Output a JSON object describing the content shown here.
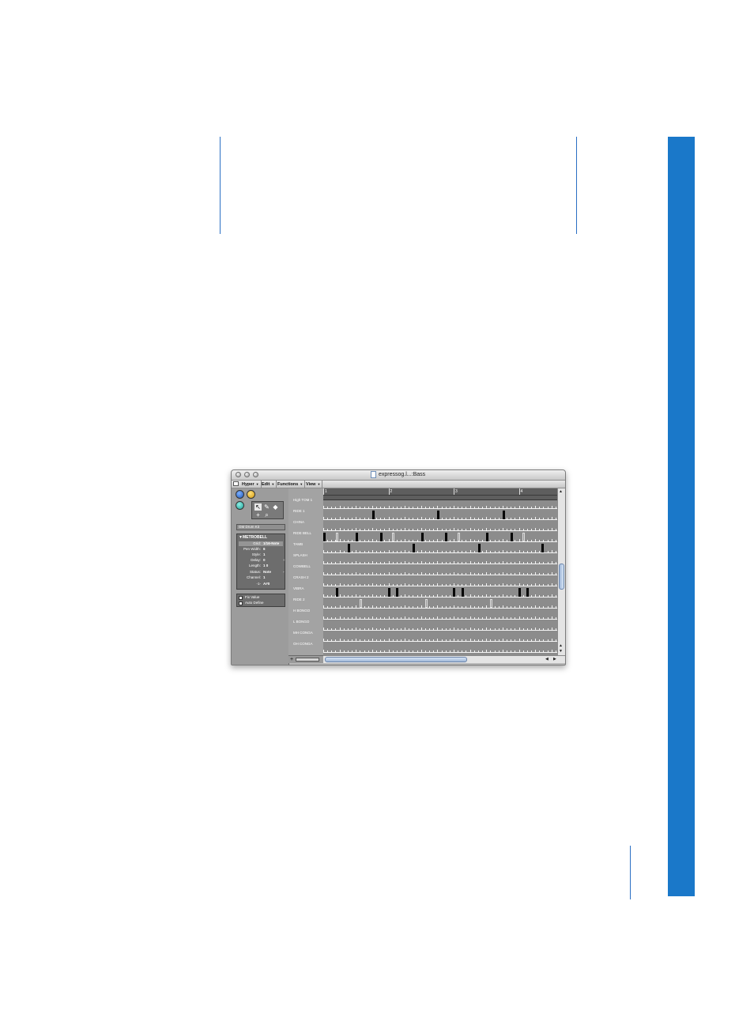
{
  "window": {
    "title": "expressog.l...:Bass"
  },
  "menu": {
    "items": [
      {
        "label": "Hyper"
      },
      {
        "label": "Edit"
      },
      {
        "label": "Functions"
      },
      {
        "label": "View"
      }
    ]
  },
  "inspector": {
    "kit_name": "GM Drum Kit",
    "section_title": "▼METROBELL",
    "params": [
      {
        "label": "Grid:",
        "value": "1/16-Note"
      },
      {
        "label": "Pen Width:",
        "value": "6"
      },
      {
        "label": "Style:",
        "value": "1"
      },
      {
        "label": "Delay:",
        "value": "0"
      },
      {
        "label": "Length:",
        "value": "1    0"
      },
      {
        "label": "Status:",
        "value": "Note"
      },
      {
        "label": "Channel:",
        "value": "1"
      },
      {
        "label": "-1-",
        "value": "A#0"
      }
    ],
    "checkboxes": [
      {
        "label": "Fix Value"
      },
      {
        "label": "Auto Define"
      }
    ]
  },
  "ruler": {
    "bars": [
      "1",
      "2",
      "3",
      "4"
    ]
  },
  "lanes": [
    {
      "name": "High TOM 1",
      "notes": []
    },
    {
      "name": "RIDE 1",
      "notes": [
        {
          "bar": 1.75,
          "shade": "black"
        },
        {
          "bar": 2.75,
          "shade": "black"
        },
        {
          "bar": 3.75,
          "shade": "black"
        }
      ]
    },
    {
      "name": "CHINA",
      "notes": []
    },
    {
      "name": "RIDE BELL",
      "notes": [
        {
          "bar": 1.0,
          "shade": "black"
        },
        {
          "bar": 1.19,
          "shade": "grey"
        },
        {
          "bar": 1.5,
          "shade": "black"
        },
        {
          "bar": 1.87,
          "shade": "black"
        },
        {
          "bar": 2.06,
          "shade": "grey"
        },
        {
          "bar": 2.5,
          "shade": "black"
        },
        {
          "bar": 2.87,
          "shade": "black"
        },
        {
          "bar": 3.06,
          "shade": "grey"
        },
        {
          "bar": 3.5,
          "shade": "black"
        },
        {
          "bar": 3.87,
          "shade": "black"
        },
        {
          "bar": 4.06,
          "shade": "grey"
        }
      ]
    },
    {
      "name": "TAMB",
      "notes": [
        {
          "bar": 1.37,
          "shade": "black"
        },
        {
          "bar": 2.37,
          "shade": "black"
        },
        {
          "bar": 3.37,
          "shade": "black"
        },
        {
          "bar": 4.34,
          "shade": "black"
        }
      ]
    },
    {
      "name": "SPLASH",
      "notes": []
    },
    {
      "name": "COWBELL",
      "notes": []
    },
    {
      "name": "CRASH 2",
      "notes": []
    },
    {
      "name": "VIBRA",
      "notes": [
        {
          "bar": 1.19,
          "shade": "black"
        },
        {
          "bar": 1.99,
          "shade": "black"
        },
        {
          "bar": 2.12,
          "shade": "black"
        },
        {
          "bar": 2.99,
          "shade": "black"
        },
        {
          "bar": 3.12,
          "shade": "black"
        },
        {
          "bar": 3.99,
          "shade": "black"
        },
        {
          "bar": 4.12,
          "shade": "black"
        }
      ]
    },
    {
      "name": "RIDE 2",
      "notes": [
        {
          "bar": 1.56,
          "shade": "grey"
        },
        {
          "bar": 2.56,
          "shade": "grey"
        },
        {
          "bar": 3.56,
          "shade": "grey"
        }
      ]
    },
    {
      "name": "H BONGO",
      "notes": []
    },
    {
      "name": "L BONGO",
      "notes": []
    },
    {
      "name": "MH CONGA",
      "notes": []
    },
    {
      "name": "OH CONGA",
      "notes": []
    }
  ],
  "colors": {
    "accent_tab": "#1a78c9",
    "lane_background": "#8c8c8c",
    "note_black": "#111111",
    "note_grey": "#9a9a9a"
  },
  "icons": [
    "window-icon",
    "hyper-icon",
    "catch-icon",
    "midi-out-icon",
    "pointer-icon",
    "pencil-icon",
    "eraser-icon",
    "crosshair-icon",
    "zoom-icon",
    "document-icon"
  ]
}
